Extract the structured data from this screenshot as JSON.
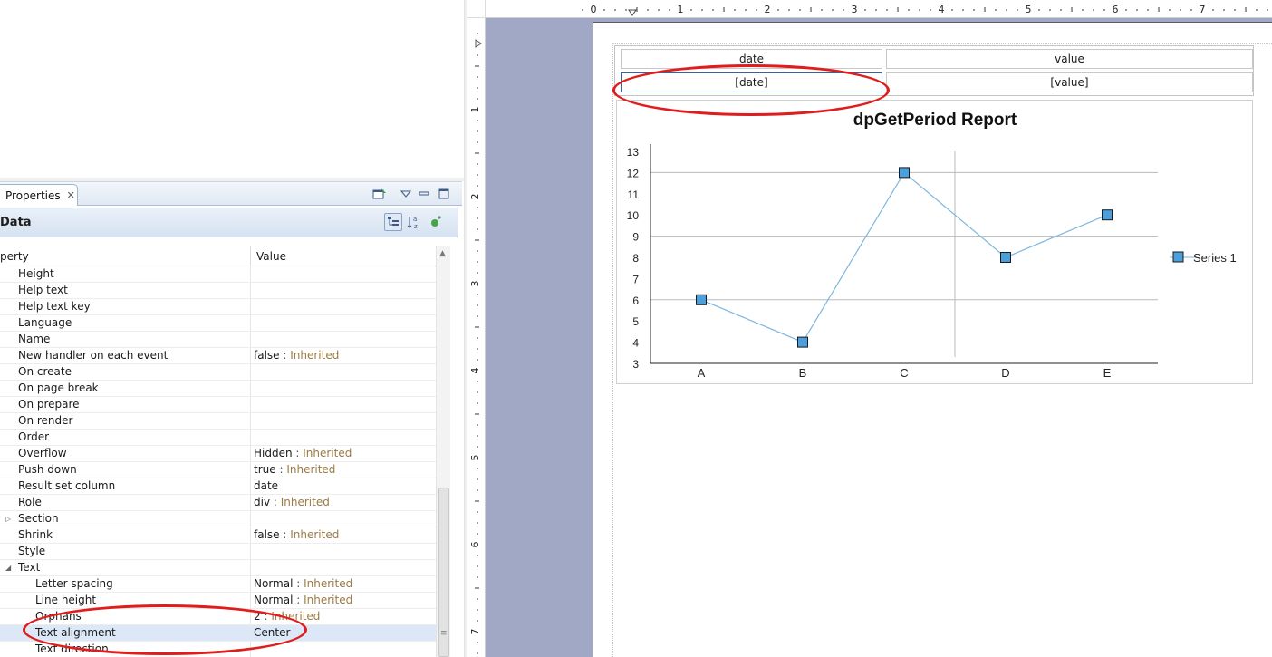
{
  "properties_view": {
    "tab_label": "Properties",
    "title": "Data",
    "column_property": "perty",
    "column_value": "Value",
    "rows": [
      {
        "name": "Height",
        "value": "",
        "inherited": ""
      },
      {
        "name": "Help text",
        "value": "",
        "inherited": ""
      },
      {
        "name": "Help text key",
        "value": "",
        "inherited": ""
      },
      {
        "name": "Language",
        "value": "",
        "inherited": ""
      },
      {
        "name": "Name",
        "value": "",
        "inherited": ""
      },
      {
        "name": "New handler on each event",
        "value": "false",
        "inherited": "Inherited"
      },
      {
        "name": "On create",
        "value": "",
        "inherited": ""
      },
      {
        "name": "On page break",
        "value": "",
        "inherited": ""
      },
      {
        "name": "On prepare",
        "value": "",
        "inherited": ""
      },
      {
        "name": "On render",
        "value": "",
        "inherited": ""
      },
      {
        "name": "Order",
        "value": "",
        "inherited": ""
      },
      {
        "name": "Overflow",
        "value": "Hidden",
        "inherited": "Inherited"
      },
      {
        "name": "Push down",
        "value": "true",
        "inherited": "Inherited"
      },
      {
        "name": "Result set column",
        "value": "date",
        "inherited": ""
      },
      {
        "name": "Role",
        "value": "div",
        "inherited": "Inherited"
      },
      {
        "name": "Section",
        "value": "",
        "inherited": "",
        "expander": "collapsed"
      },
      {
        "name": "Shrink",
        "value": "false",
        "inherited": "Inherited"
      },
      {
        "name": "Style",
        "value": "",
        "inherited": ""
      },
      {
        "name": "Text",
        "value": "",
        "inherited": "",
        "expander": "expanded"
      },
      {
        "name": "Letter spacing",
        "value": "Normal",
        "inherited": "Inherited",
        "child": true
      },
      {
        "name": "Line height",
        "value": "Normal",
        "inherited": "Inherited",
        "child": true
      },
      {
        "name": "Orphans",
        "value": "2",
        "inherited": "Inherited",
        "child": true
      },
      {
        "name": "Text alignment",
        "value": "Center",
        "inherited": "",
        "child": true,
        "selected": true
      },
      {
        "name": "Text direction",
        "value": "",
        "inherited": "",
        "child": true
      }
    ]
  },
  "report": {
    "ruler_h": [
      "0",
      "1",
      "2",
      "3",
      "4",
      "5",
      "6",
      "7"
    ],
    "ruler_v": [
      "1",
      "2",
      "3",
      "4",
      "5",
      "6",
      "7"
    ],
    "table": {
      "header": [
        "date",
        "value"
      ],
      "detail": [
        "[date]",
        "[value]"
      ]
    }
  },
  "chart_data": {
    "type": "line",
    "title": "dpGetPeriod Report",
    "categories": [
      "A",
      "B",
      "C",
      "D",
      "E"
    ],
    "series": [
      {
        "name": "Series 1",
        "values": [
          6,
          4,
          12,
          8,
          10
        ]
      }
    ],
    "ylim": [
      3,
      13
    ],
    "yticks": [
      3,
      4,
      5,
      6,
      7,
      8,
      9,
      10,
      11,
      12,
      13
    ],
    "xlabel": "",
    "ylabel": "",
    "legend": "right",
    "colors": {
      "line": "#7fb7de",
      "marker": "#4aa0dc",
      "marker_border": "#1a1a1a",
      "grid": "#b9b9b9"
    }
  },
  "annotation_color": "#e01c1c"
}
